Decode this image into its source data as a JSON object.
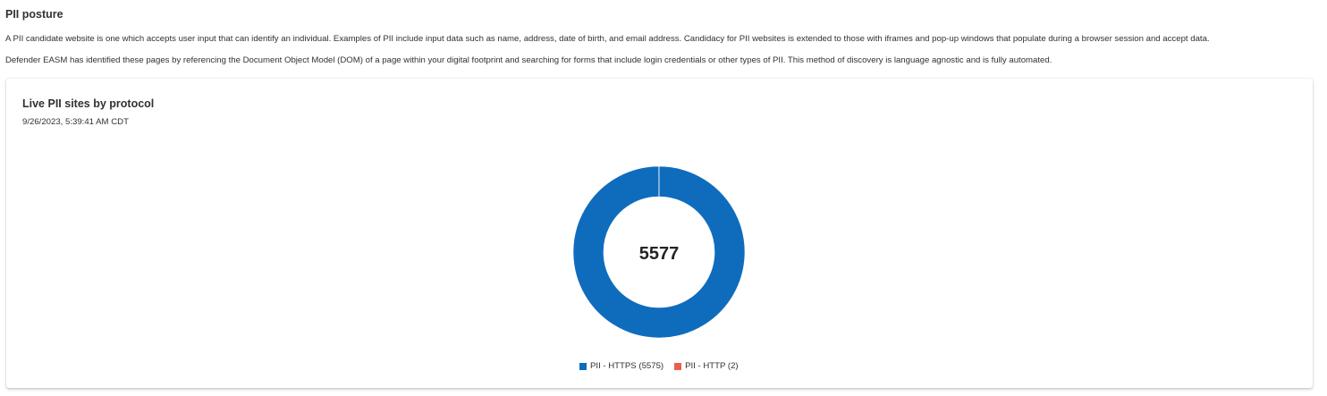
{
  "section": {
    "title": "PII posture",
    "description_1": "A PII candidate website is one which accepts user input that can identify an individual. Examples of PII include input data such as name, address, date of birth, and email address. Candidacy for PII websites is extended to those with iframes and pop-up windows that populate during a browser session and accept data.",
    "description_2": "Defender EASM has identified these pages by referencing the Document Object Model (DOM) of a page within your digital footprint and searching for forms that include login credentials or other types of PII. This method of discovery is language agnostic and is fully automated."
  },
  "card": {
    "title": "Live PII sites by protocol",
    "timestamp": "9/26/2023, 5:39:41 AM CDT",
    "center_total": "5577"
  },
  "legend": [
    {
      "label": "PII - HTTPS (5575)",
      "color": "#0f6cbd"
    },
    {
      "label": "PII - HTTP (2)",
      "color": "#e8604c"
    }
  ],
  "chart_data": {
    "type": "pie",
    "style": "donut",
    "total": 5577,
    "categories": [
      "PII - HTTPS",
      "PII - HTTP"
    ],
    "values": [
      5575,
      2
    ],
    "colors": [
      "#0f6cbd",
      "#e8604c"
    ],
    "legend_position": "bottom-center"
  }
}
